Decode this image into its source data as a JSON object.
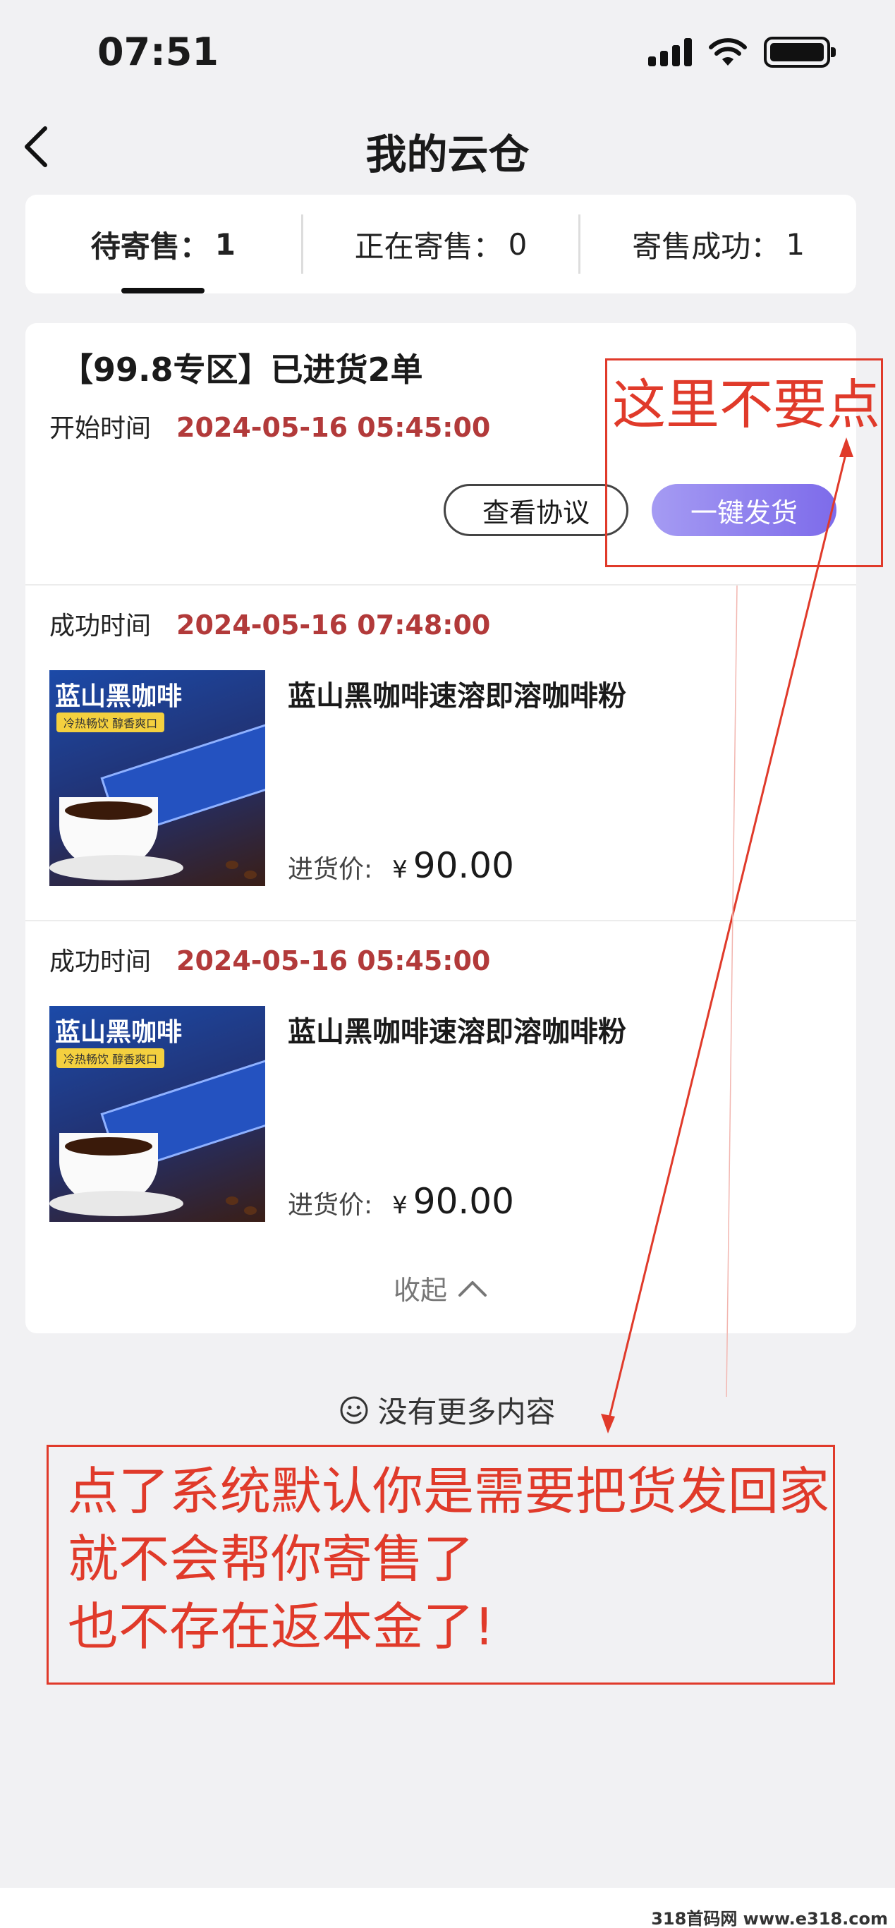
{
  "status_bar": {
    "time": "07:51"
  },
  "header": {
    "title": "我的云仓"
  },
  "tabs": [
    {
      "label": "待寄售：",
      "count": "1"
    },
    {
      "label": "正在寄售：",
      "count": "0"
    },
    {
      "label": "寄售成功：",
      "count": "1"
    }
  ],
  "order": {
    "zone_title": "【99.8专区】已进货2单",
    "start_label": "开始时间",
    "start_time": "2024-05-16 05:45:00",
    "view_agreement_label": "查看协议",
    "ship_label": "一键发货"
  },
  "items": [
    {
      "success_label": "成功时间",
      "success_time": "2024-05-16 07:48:00",
      "name": "蓝山黑咖啡速溶即溶咖啡粉",
      "price_label": "进货价:",
      "currency": "¥",
      "price": "90.00",
      "image_title": "蓝山黑咖啡",
      "image_badge": "冷热畅饮  醇香爽口"
    },
    {
      "success_label": "成功时间",
      "success_time": "2024-05-16 05:45:00",
      "name": "蓝山黑咖啡速溶即溶咖啡粉",
      "price_label": "进货价:",
      "currency": "¥",
      "price": "90.00",
      "image_title": "蓝山黑咖啡",
      "image_badge": "冷热畅饮  醇香爽口"
    }
  ],
  "collapse_label": "收起",
  "no_more_label": "没有更多内容",
  "annotations": {
    "top_note": "这里不要点",
    "bottom_lines": [
      "点了系统默认你是需要把货发回家",
      "就不会帮你寄售了",
      "也不存在返本金了!"
    ],
    "color": "#e03a2a"
  },
  "watermark": "318首码网 www.e318.com"
}
